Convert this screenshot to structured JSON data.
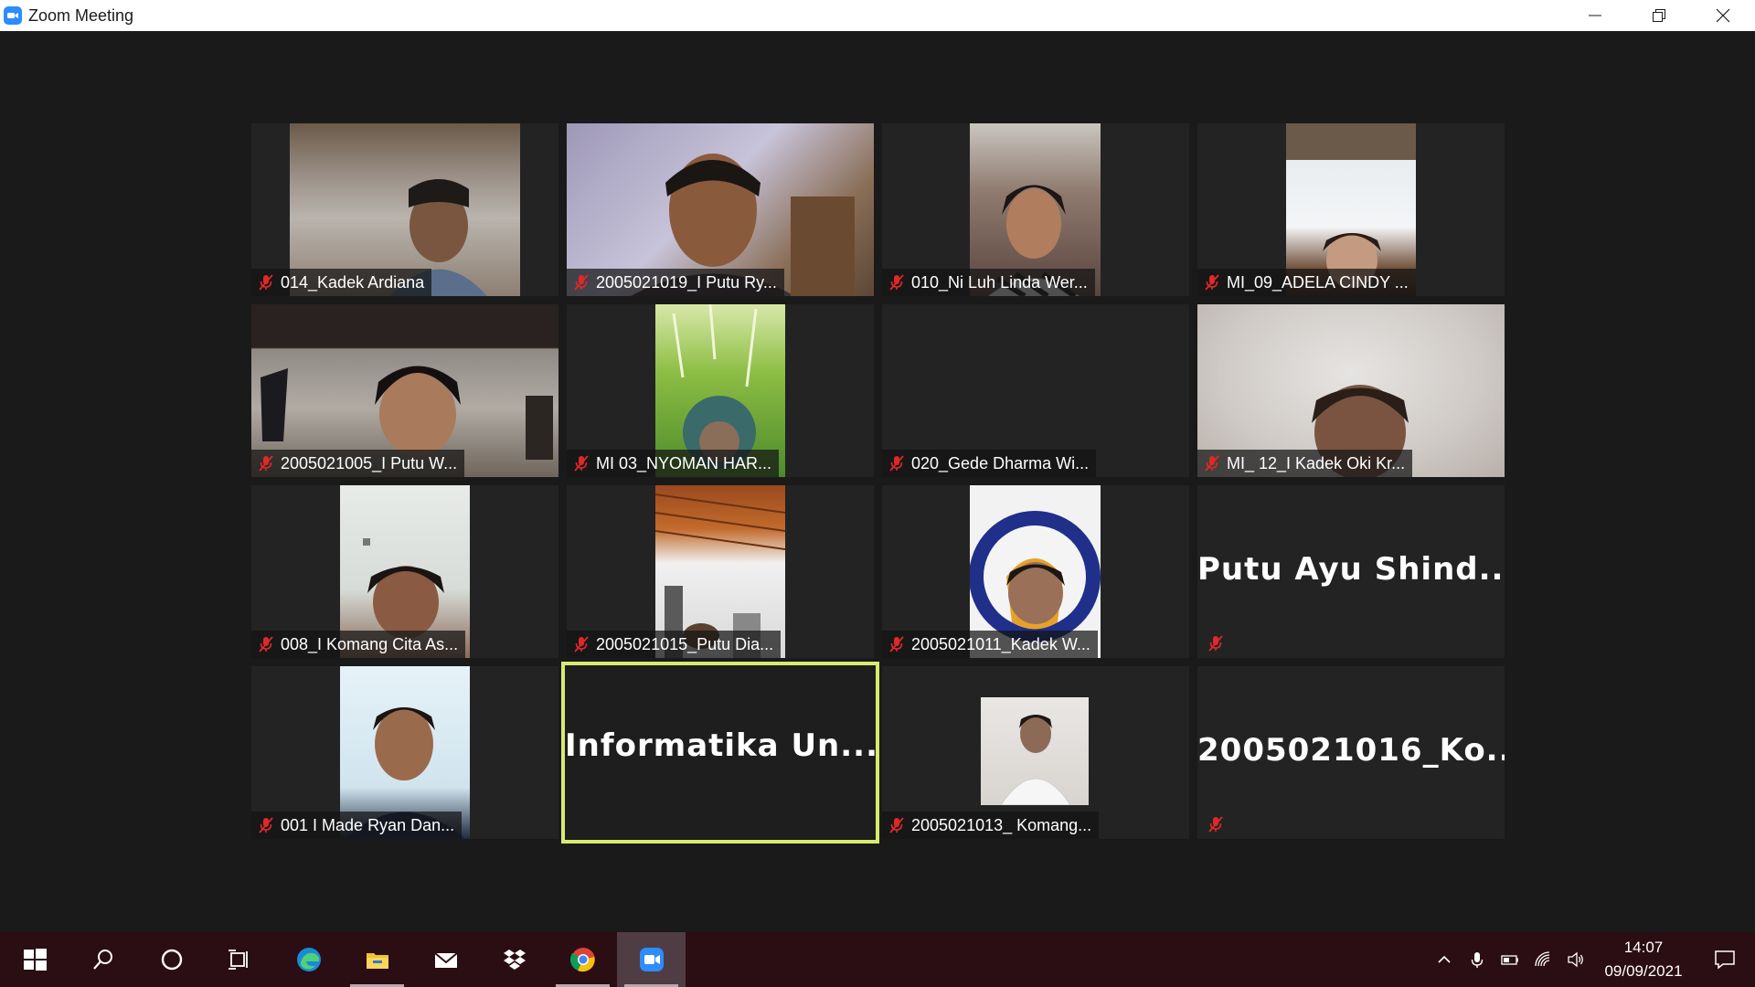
{
  "window": {
    "title": "Zoom Meeting"
  },
  "participants": [
    {
      "name": "014_Kadek Ardiana",
      "video": true,
      "muted": true
    },
    {
      "name": "2005021019_I Putu Ry...",
      "video": true,
      "muted": true
    },
    {
      "name": "010_Ni Luh Linda Wer...",
      "video": true,
      "muted": true
    },
    {
      "name": "MI_09_ADELA CINDY ...",
      "video": true,
      "muted": true
    },
    {
      "name": "2005021005_I Putu W...",
      "video": true,
      "muted": true
    },
    {
      "name": "MI 03_NYOMAN HAR...",
      "video": true,
      "muted": true
    },
    {
      "name": "020_Gede Dharma Wi...",
      "video": false,
      "muted": true
    },
    {
      "name": "MI_ 12_I Kadek Oki Kr...",
      "video": true,
      "muted": true
    },
    {
      "name": "008_I Komang Cita As...",
      "video": true,
      "muted": true
    },
    {
      "name": "2005021015_Putu Dia...",
      "video": true,
      "muted": true
    },
    {
      "name": "2005021011_Kadek W...",
      "video": true,
      "muted": true
    },
    {
      "name": "Putu Ayu Shind...",
      "video": false,
      "muted": true
    },
    {
      "name": "001 I Made Ryan Dan...",
      "video": true,
      "muted": true
    },
    {
      "name": "Informatika Un...",
      "video": false,
      "muted": false,
      "active_speaker": true
    },
    {
      "name": "2005021013_ Komang...",
      "video": true,
      "muted": true
    },
    {
      "name": "2005021016_Ko...",
      "video": false,
      "muted": true
    }
  ],
  "taskbar": {
    "apps": [
      "start-icon",
      "search-icon",
      "cortana-icon",
      "task-view-icon",
      "edge-icon",
      "file-explorer-icon",
      "mail-icon",
      "dropbox-icon",
      "chrome-icon",
      "zoom-icon"
    ],
    "time": "14:07",
    "date": "09/09/2021"
  },
  "colors": {
    "active_speaker_border": "#d7ec6f",
    "muted_mic": "#e02828",
    "zoom_blue": "#2d8cff",
    "taskbar": "#2b0d14"
  }
}
